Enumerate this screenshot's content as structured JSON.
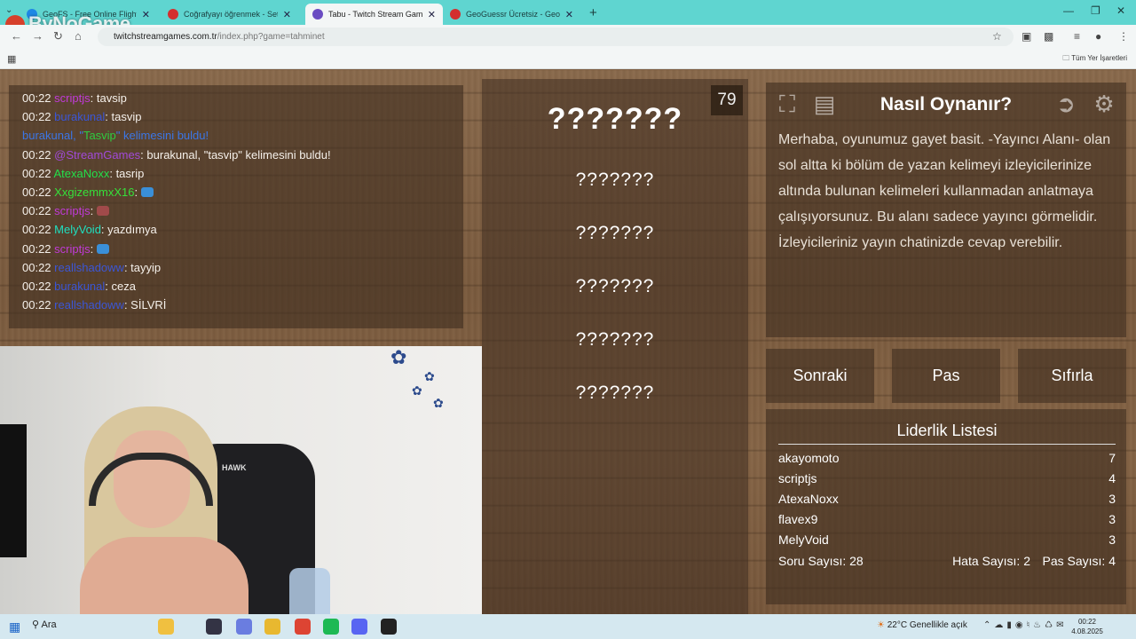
{
  "browser": {
    "tabs": [
      {
        "label": "GeoFS - Free Online Flight Sim",
        "color": "#1e88e5",
        "active": false
      },
      {
        "label": "Coğrafyayı öğrenmek - Seterra",
        "color": "#d32f2f",
        "active": false
      },
      {
        "label": "Tabu - Twitch Stream Games",
        "color": "#6a4cc2",
        "active": true
      },
      {
        "label": "GeoGuessr Ücretsiz - GeoGuess",
        "color": "#d32f2f",
        "active": false
      }
    ],
    "url_host": "twitchstreamgames.com.tr",
    "url_path": "/index.php?game=tahminet",
    "bookmarks_all": "Tüm Yer İşaretleri",
    "watermark": "ByNoGame"
  },
  "chat": {
    "lines": [
      {
        "time": "00:22",
        "user": "scriptjs",
        "user_color": "#c03ad8",
        "sep": ": ",
        "msg": "tavsip"
      },
      {
        "time": "00:22",
        "user": "burakunal",
        "user_color": "#3b56d6",
        "sep": ": ",
        "msg": "tasvip"
      },
      {
        "time": "",
        "user": "burakunal, \"",
        "user_color": "#3b76e6",
        "sep": "",
        "msg": "",
        "special": "found1"
      },
      {
        "time": "00:22",
        "user": "@StreamGames",
        "user_color": "#a14ad8",
        "sep": ": ",
        "msg": "burakunal, \"tasvip\" kelimesini buldu!"
      },
      {
        "time": "00:22",
        "user": "AtexaNoxx",
        "user_color": "#23e04a",
        "sep": ": ",
        "msg": "tasrip"
      },
      {
        "time": "00:22",
        "user": "XxgizemmxX16",
        "user_color": "#36e03a",
        "sep": ": ",
        "msg": "",
        "emote": "#3a8fd8"
      },
      {
        "time": "00:22",
        "user": "scriptjs",
        "user_color": "#c03ad8",
        "sep": ": ",
        "msg": "",
        "emote": "#a04a4a"
      },
      {
        "time": "00:22",
        "user": "MelyVoid",
        "user_color": "#20e0c0",
        "sep": ": ",
        "msg": "yazdımya"
      },
      {
        "time": "00:22",
        "user": "scriptjs",
        "user_color": "#c03ad8",
        "sep": ": ",
        "msg": "",
        "emote": "#3a8fd8"
      },
      {
        "time": "00:22",
        "user": "reallshadoww",
        "user_color": "#3b56d6",
        "sep": ": ",
        "msg": "tayyip"
      },
      {
        "time": "00:22",
        "user": "burakunal",
        "user_color": "#3b56d6",
        "sep": ": ",
        "msg": "ceza"
      },
      {
        "time": "00:22",
        "user": "reallshadoww",
        "user_color": "#3b56d6",
        "sep": ": ",
        "msg": "SİLVRİ"
      }
    ],
    "found_line": {
      "prefix": "burakunal, \"",
      "word": "Tasvip",
      "suffix": "\" kelimesini buldu!"
    }
  },
  "game": {
    "counter": "79",
    "main_word": "???????",
    "taboo_words": [
      "???????",
      "???????",
      "???????",
      "???????",
      "???????"
    ]
  },
  "help": {
    "title": "Nasıl Oynanır?",
    "text": "Merhaba, oyunumuz gayet basit. -Yayıncı Alanı- olan sol altta ki bölüm de yazan kelimeyi izleyicilerinize altında bulunan kelimeleri kullanmadan anlatmaya çalışıyorsunuz. Bu alanı sadece yayıncı görmelidir. İzleyicileriniz yayın chatinizde cevap verebilir."
  },
  "buttons": {
    "next": "Sonraki",
    "pass": "Pas",
    "reset": "Sıfırla"
  },
  "leaderboard": {
    "title": "Liderlik Listesi",
    "rows": [
      {
        "name": "akayomoto",
        "score": "7"
      },
      {
        "name": "scriptjs",
        "score": "4"
      },
      {
        "name": "AtexaNoxx",
        "score": "3"
      },
      {
        "name": "flavex9",
        "score": "3"
      },
      {
        "name": "MelyVoid",
        "score": "3"
      }
    ],
    "question_count": "Soru Sayısı: 28",
    "error_count": "Hata Sayısı: 2",
    "pass_count": "Pas Sayısı: 4"
  },
  "webcam": {
    "chair_brand": "HAWK"
  },
  "taskbar": {
    "search": "Ara",
    "weather": "22°C  Genellikle açık",
    "time": "00:22",
    "date": "4.08.2025"
  }
}
